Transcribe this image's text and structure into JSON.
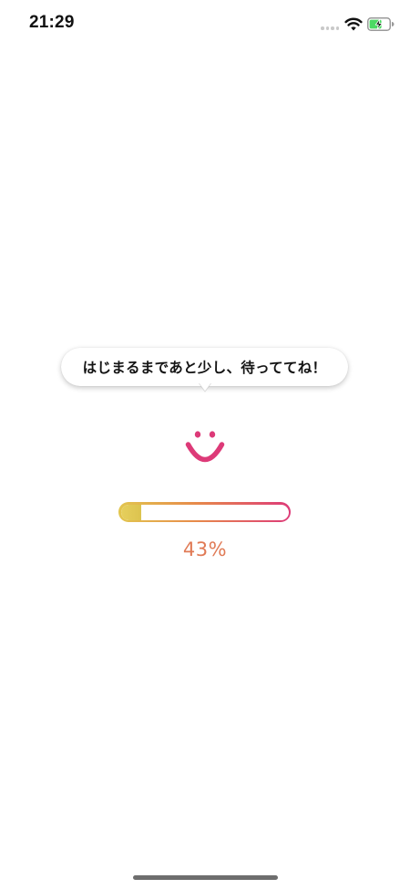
{
  "status_bar": {
    "time": "21:29",
    "icons": [
      "cellular-dots-icon",
      "wifi-icon",
      "battery-charging-icon"
    ]
  },
  "loading": {
    "message": "はじまるまであと少し、待っててね！",
    "progress_percent": 43,
    "progress_bar_fill_fraction": 0.12,
    "progress_label": "43%",
    "mascot_icon": "smiley-face-icon"
  },
  "colors": {
    "accent_pink": "#dd3a78",
    "accent_orange": "#e07a55",
    "accent_yellow": "#e2c64e",
    "battery_green": "#4cd964"
  }
}
